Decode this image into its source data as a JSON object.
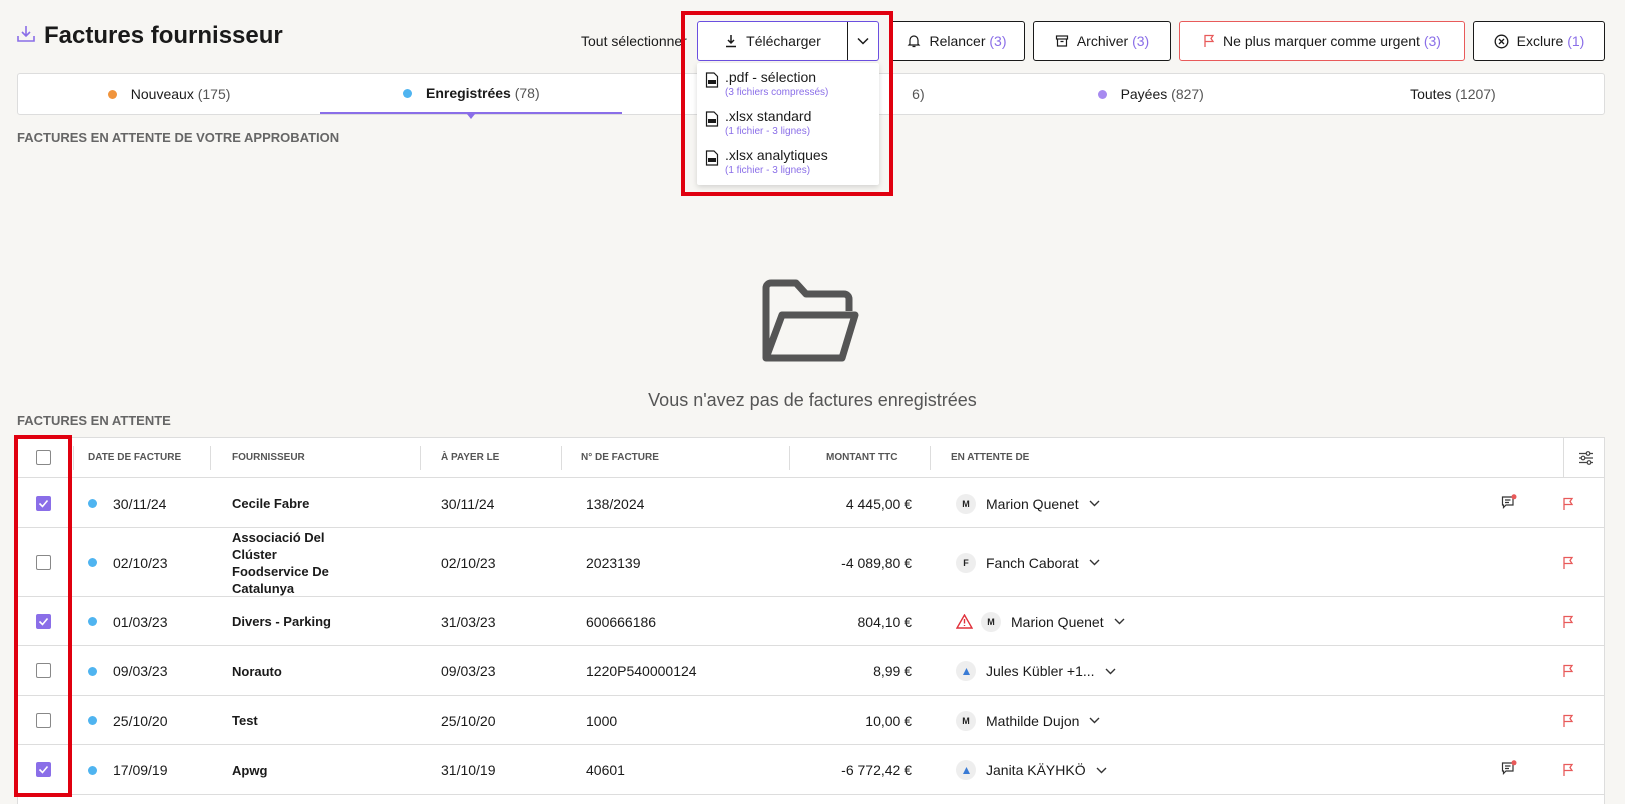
{
  "header": {
    "title": "Factures fournisseur",
    "select_all": "Tout sélectionner"
  },
  "toolbar": {
    "download_label": "Télécharger",
    "remind_label": "Relancer",
    "remind_count": "(3)",
    "archive_label": "Archiver",
    "archive_count": "(3)",
    "unurgent_label": "Ne plus marquer comme urgent",
    "unurgent_count": "(3)",
    "exclude_label": "Exclure",
    "exclude_count": "(1)"
  },
  "download_menu": [
    {
      "label": ".pdf - sélection",
      "sub": "(3 fichiers compressés)"
    },
    {
      "label": ".xlsx standard",
      "sub": "(1 fichier - 3 lignes)"
    },
    {
      "label": ".xlsx analytiques",
      "sub": "(1 fichier - 3 lignes)"
    }
  ],
  "tabs": [
    {
      "label": "Nouveaux",
      "count": "(175)",
      "dot": "#f0943c"
    },
    {
      "label": "Enregistrées",
      "count": "(78)",
      "dot": "#4fb4f0"
    },
    {
      "label": "",
      "count": "6)",
      "dot": ""
    },
    {
      "label": "Payées",
      "count": "(827)",
      "dot": "#a78af0"
    },
    {
      "label": "Toutes",
      "count": "(1207)",
      "dot": ""
    }
  ],
  "sections": {
    "approval": "FACTURES EN ATTENTE DE VOTRE APPROBATION",
    "pending": "FACTURES EN ATTENTE"
  },
  "empty_state": {
    "text": "Vous n'avez pas de factures enregistrées"
  },
  "table": {
    "columns": {
      "date": "DATE DE FACTURE",
      "supplier": "FOURNISSEUR",
      "due": "À PAYER LE",
      "number": "N° DE FACTURE",
      "amount": "MONTANT TTC",
      "waiting": "EN ATTENTE DE"
    },
    "rows": [
      {
        "checked": true,
        "date": "30/11/24",
        "supplier": "Cecile Fabre",
        "due": "30/11/24",
        "number": "138/2024",
        "amount": "4 445,00 €",
        "initial": "M",
        "person": "Marion Quenet",
        "warn": false,
        "comment": true
      },
      {
        "checked": false,
        "date": "02/10/23",
        "supplier": "Associació Del Clúster Foodservice De Catalunya",
        "due": "02/10/23",
        "number": "2023139",
        "amount": "-4 089,80 €",
        "initial": "F",
        "person": "Fanch Caborat",
        "warn": false,
        "comment": false
      },
      {
        "checked": true,
        "date": "01/03/23",
        "supplier": "Divers - Parking",
        "due": "31/03/23",
        "number": "600666186",
        "amount": "804,10 €",
        "initial": "M",
        "person": "Marion Quenet",
        "warn": true,
        "comment": false
      },
      {
        "checked": false,
        "date": "09/03/23",
        "supplier": "Norauto",
        "due": "09/03/23",
        "number": "1220P540000124",
        "amount": "8,99 €",
        "initial": "",
        "person": "Jules Kübler +1...",
        "warn": false,
        "comment": false
      },
      {
        "checked": false,
        "date": "25/10/20",
        "supplier": "Test",
        "due": "25/10/20",
        "number": "1000",
        "amount": "10,00 €",
        "initial": "M",
        "person": "Mathilde Dujon",
        "warn": false,
        "comment": false
      },
      {
        "checked": true,
        "date": "17/09/19",
        "supplier": "Apwg",
        "due": "31/10/19",
        "number": "40601",
        "amount": "-6 772,42 €",
        "initial": "",
        "person": "Janita KÄYHKÖ",
        "warn": false,
        "comment": true
      }
    ]
  },
  "colors": {
    "accent": "#8a6ee8",
    "highlight": "#e0000f",
    "urgent": "#e85a5a",
    "status_dot": "#4fb4f0"
  }
}
